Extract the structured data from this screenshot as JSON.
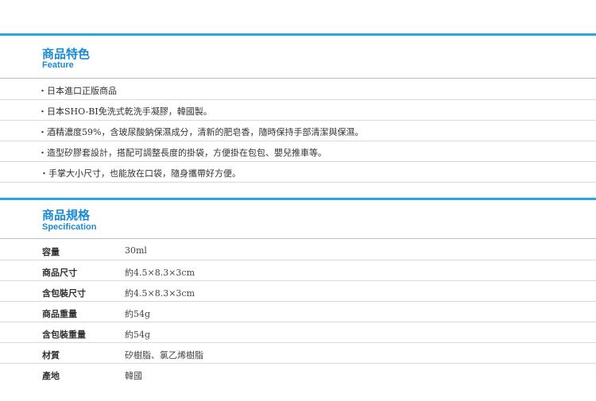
{
  "feature": {
    "title": "商品特色",
    "subtitle": "Feature",
    "items": [
      "・日本進口正版商品",
      "・日本SHO-BI免洗式乾洗手凝膠，韓國製。",
      "・酒精濃度59%，含玻尿酸鈉保濕成分，清新的肥皂香，隨時保持手部清潔與保濕。",
      "・造型矽膠套設計，搭配可調整長度的掛袋，方便掛在包包、嬰兒推車等。",
      "・手掌大小尺寸，也能放在口袋，隨身攜帶好方便。"
    ]
  },
  "spec": {
    "title": "商品規格",
    "subtitle": "Specification",
    "rows": [
      {
        "label": "容量",
        "value": "30ml"
      },
      {
        "label": "商品尺寸",
        "value": "約4.5×8.3×3cm"
      },
      {
        "label": "含包裝尺寸",
        "value": "約4.5×8.3×3cm"
      },
      {
        "label": "商品重量",
        "value": "約54g"
      },
      {
        "label": "含包裝重量",
        "value": "約54g"
      },
      {
        "label": "材質",
        "value": "矽樹脂、氯乙烯樹脂"
      },
      {
        "label": "產地",
        "value": "韓國"
      }
    ]
  }
}
